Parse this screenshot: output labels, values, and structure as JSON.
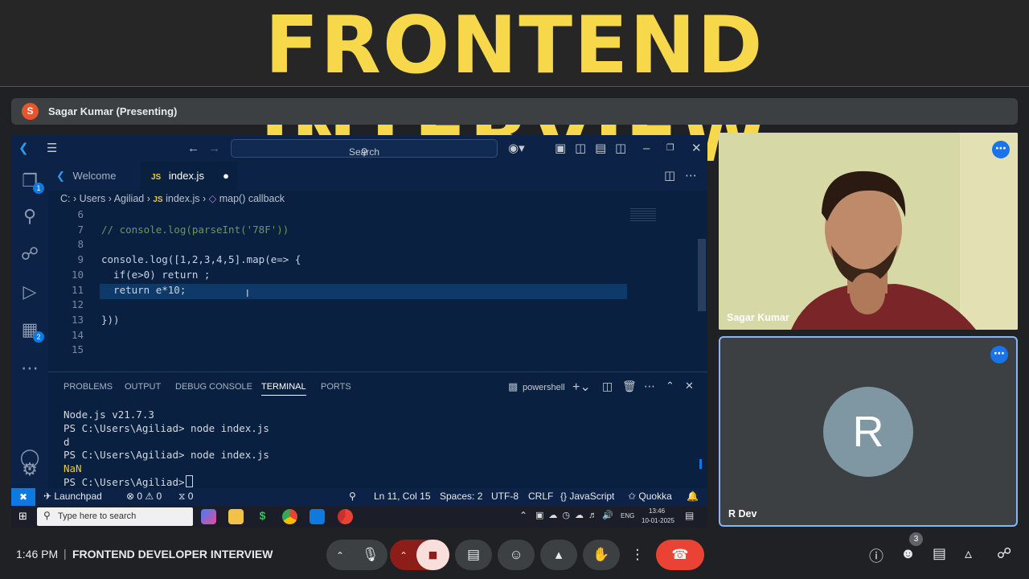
{
  "banner": {
    "title": "FRONTEND INTERVIEW"
  },
  "presenter": {
    "initial": "S",
    "name": "Sagar Kumar (Presenting)"
  },
  "vscode": {
    "search_label": "Search",
    "tabs": [
      {
        "label": "Welcome"
      },
      {
        "label": "index.js",
        "lang": "JS"
      }
    ],
    "breadcrumb": {
      "root": "C:",
      "users": "Users",
      "user": "Agiliad",
      "lang": "JS",
      "file": "index.js",
      "symbol": "map() callback"
    },
    "activity_badges": {
      "explorer": "1",
      "extensions": "2"
    },
    "code_lines": [
      {
        "n": "6",
        "text": ""
      },
      {
        "n": "7",
        "text": "// console.log(parseInt('78F'))"
      },
      {
        "n": "8",
        "text": ""
      },
      {
        "n": "9",
        "text": "console.log([1,2,3,4,5].map(e=> {"
      },
      {
        "n": "10",
        "text": "  if(e>0) return ;"
      },
      {
        "n": "11",
        "text": "  return e*10;"
      },
      {
        "n": "12",
        "text": ""
      },
      {
        "n": "13",
        "text": "}))"
      },
      {
        "n": "14",
        "text": ""
      },
      {
        "n": "15",
        "text": ""
      }
    ],
    "panel_tabs": [
      "PROBLEMS",
      "OUTPUT",
      "DEBUG CONSOLE",
      "TERMINAL",
      "PORTS"
    ],
    "shell": "powershell",
    "terminal_lines": [
      "Node.js v21.7.3",
      "PS C:\\Users\\Agiliad> node index.js",
      "d",
      "PS C:\\Users\\Agiliad> node index.js",
      "NaN",
      "PS C:\\Users\\Agiliad> "
    ],
    "status": {
      "launchpad": "Launchpad",
      "errors": "0",
      "warnings": "0",
      "ports": "0",
      "position": "Ln 11, Col 15",
      "spaces": "Spaces: 2",
      "encoding": "UTF-8",
      "eol": "CRLF",
      "language": "JavaScript",
      "quokka": "Quokka"
    }
  },
  "taskbar": {
    "search_placeholder": "Type here to search",
    "lang": "ENG",
    "time": "13:46",
    "date": "10-01-2025"
  },
  "participants": [
    {
      "name": "Sagar Kumar"
    },
    {
      "name": "R Dev",
      "initial": "R"
    }
  ],
  "meeting": {
    "time": "1:46 PM",
    "title": "FRONTEND DEVELOPER INTERVIEW",
    "people_count": "3"
  }
}
